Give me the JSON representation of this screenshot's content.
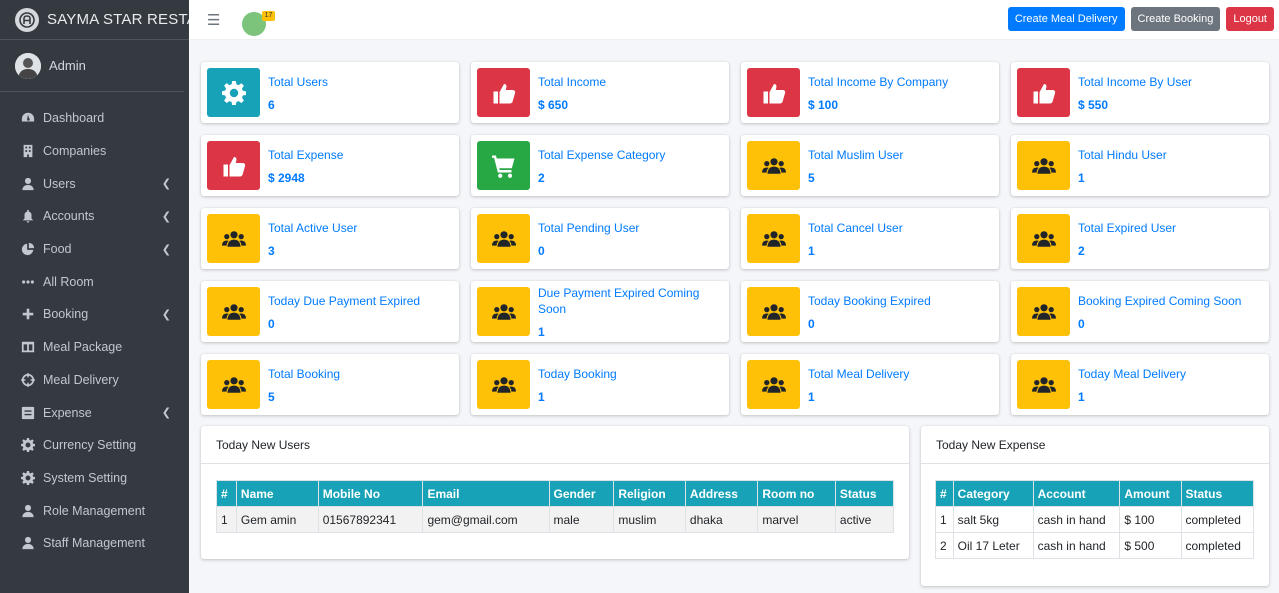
{
  "brand": {
    "name": "SAYMA STAR RESTAURANT"
  },
  "user": {
    "name": "Admin"
  },
  "sidebar": {
    "items": [
      {
        "label": "Dashboard",
        "icon": "dashboard-icon",
        "has_submenu": false
      },
      {
        "label": "Companies",
        "icon": "building-icon",
        "has_submenu": false
      },
      {
        "label": "Users",
        "icon": "user-icon",
        "has_submenu": true
      },
      {
        "label": "Accounts",
        "icon": "bell-icon",
        "has_submenu": true
      },
      {
        "label": "Food",
        "icon": "pie-chart-icon",
        "has_submenu": true
      },
      {
        "label": "All Room",
        "icon": "ellipsis-icon",
        "has_submenu": false
      },
      {
        "label": "Booking",
        "icon": "plus-icon",
        "has_submenu": true
      },
      {
        "label": "Meal Package",
        "icon": "columns-icon",
        "has_submenu": false
      },
      {
        "label": "Meal Delivery",
        "icon": "crosshair-icon",
        "has_submenu": false
      },
      {
        "label": "Expense",
        "icon": "list-icon",
        "has_submenu": true
      },
      {
        "label": "Currency Setting",
        "icon": "gear-icon",
        "has_submenu": false
      },
      {
        "label": "System Setting",
        "icon": "gear-icon",
        "has_submenu": false
      },
      {
        "label": "Role Management",
        "icon": "user-icon",
        "has_submenu": false
      },
      {
        "label": "Staff Management",
        "icon": "user-icon",
        "has_submenu": false
      }
    ]
  },
  "topbar": {
    "notification_count": "17",
    "create_meal_delivery": "Create Meal Delivery",
    "create_booking": "Create Booking",
    "logout": "Logout"
  },
  "stats": [
    {
      "title": "Total Users",
      "value": "6",
      "icon": "gear-icon",
      "color": "#17a2b8"
    },
    {
      "title": "Total Income",
      "value": "$ 650",
      "icon": "thumbs-up-icon",
      "color": "#dc3545"
    },
    {
      "title": "Total Income By Company",
      "value": "$ 100",
      "icon": "thumbs-up-icon",
      "color": "#dc3545"
    },
    {
      "title": "Total Income By User",
      "value": "$ 550",
      "icon": "thumbs-up-icon",
      "color": "#dc3545"
    },
    {
      "title": "Total Expense",
      "value": "$ 2948",
      "icon": "thumbs-up-icon",
      "color": "#dc3545"
    },
    {
      "title": "Total Expense Category",
      "value": "2",
      "icon": "shopping-cart-icon",
      "color": "#28a745"
    },
    {
      "title": "Total Muslim User",
      "value": "5",
      "icon": "users-icon",
      "color": "#ffc107"
    },
    {
      "title": "Total Hindu User",
      "value": "1",
      "icon": "users-icon",
      "color": "#ffc107"
    },
    {
      "title": "Total Active User",
      "value": "3",
      "icon": "users-icon",
      "color": "#ffc107"
    },
    {
      "title": "Total Pending User",
      "value": "0",
      "icon": "users-icon",
      "color": "#ffc107"
    },
    {
      "title": "Total Cancel User",
      "value": "1",
      "icon": "users-icon",
      "color": "#ffc107"
    },
    {
      "title": "Total Expired User",
      "value": "2",
      "icon": "users-icon",
      "color": "#ffc107"
    },
    {
      "title": "Today Due Payment Expired",
      "value": "0",
      "icon": "users-icon",
      "color": "#ffc107"
    },
    {
      "title": "Due Payment Expired Coming Soon",
      "value": "1",
      "icon": "users-icon",
      "color": "#ffc107"
    },
    {
      "title": "Today Booking Expired",
      "value": "0",
      "icon": "users-icon",
      "color": "#ffc107"
    },
    {
      "title": "Booking Expired Coming Soon",
      "value": "0",
      "icon": "users-icon",
      "color": "#ffc107"
    },
    {
      "title": "Total Booking",
      "value": "5",
      "icon": "users-icon",
      "color": "#ffc107"
    },
    {
      "title": "Today Booking",
      "value": "1",
      "icon": "users-icon",
      "color": "#ffc107"
    },
    {
      "title": "Total Meal Delivery",
      "value": "1",
      "icon": "users-icon",
      "color": "#ffc107"
    },
    {
      "title": "Today Meal Delivery",
      "value": "1",
      "icon": "users-icon",
      "color": "#ffc107"
    }
  ],
  "new_users": {
    "title": "Today New Users",
    "columns": [
      "#",
      "Name",
      "Mobile No",
      "Email",
      "Gender",
      "Religion",
      "Address",
      "Room no",
      "Status"
    ],
    "rows": [
      [
        "1",
        "Gem amin",
        "01567892341",
        "gem@gmail.com",
        "male",
        "muslim",
        "dhaka",
        "marvel",
        "active"
      ]
    ]
  },
  "new_expense": {
    "title": "Today New Expense",
    "columns": [
      "#",
      "Category",
      "Account",
      "Amount",
      "Status"
    ],
    "rows": [
      [
        "1",
        "salt 5kg",
        "cash in hand",
        "$ 100",
        "completed"
      ],
      [
        "2",
        "Oil 17 Leter",
        "cash in hand",
        "$ 500",
        "completed"
      ]
    ]
  }
}
